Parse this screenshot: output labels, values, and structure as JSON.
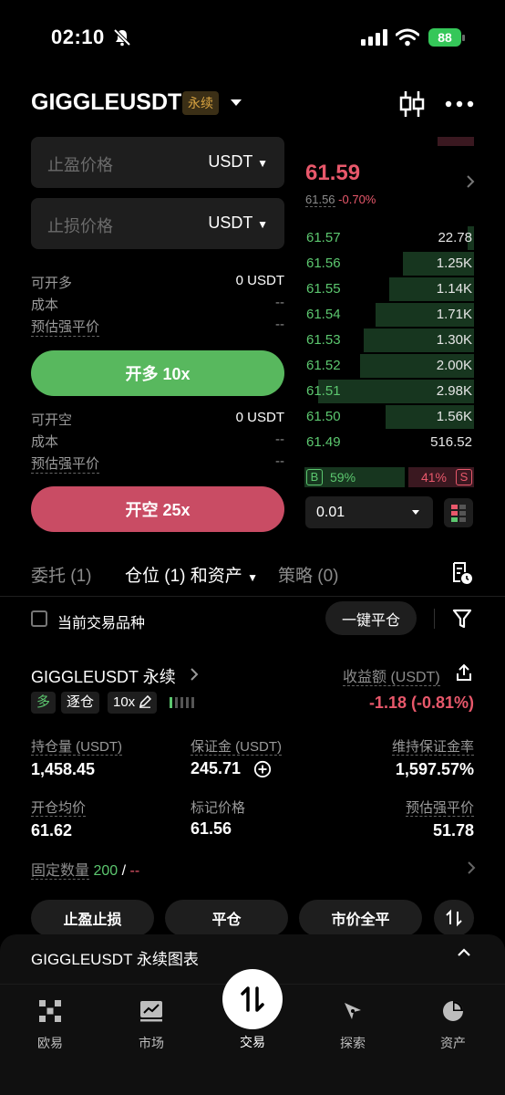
{
  "status": {
    "time": "02:10",
    "battery": "88"
  },
  "header": {
    "symbol": "GIGGLEUSDT",
    "tag": "永续"
  },
  "inputs": [
    {
      "placeholder": "止盈价格",
      "unit": "USDT"
    },
    {
      "placeholder": "止损价格",
      "unit": "USDT"
    }
  ],
  "long": {
    "rows": [
      {
        "label": "可开多",
        "value": "0 USDT"
      },
      {
        "label": "成本",
        "value": "--"
      },
      {
        "label": "预估强平价",
        "value": "--"
      }
    ],
    "button": "开多 10x"
  },
  "short": {
    "rows": [
      {
        "label": "可开空",
        "value": "0 USDT"
      },
      {
        "label": "成本",
        "value": "--"
      },
      {
        "label": "预估强平价",
        "value": "--"
      }
    ],
    "button": "开空 25x"
  },
  "orderbook": {
    "last_price": "61.59",
    "mark_price": "61.56",
    "change": "-0.70%",
    "bids": [
      {
        "price": "61.57",
        "qty": "22.78",
        "depth": 0.04
      },
      {
        "price": "61.56",
        "qty": "1.25K",
        "depth": 0.42
      },
      {
        "price": "61.55",
        "qty": "1.14K",
        "depth": 0.5
      },
      {
        "price": "61.54",
        "qty": "1.71K",
        "depth": 0.58
      },
      {
        "price": "61.53",
        "qty": "1.30K",
        "depth": 0.65
      },
      {
        "price": "61.52",
        "qty": "2.00K",
        "depth": 0.67
      },
      {
        "price": "61.51",
        "qty": "2.98K",
        "depth": 0.92
      },
      {
        "price": "61.50",
        "qty": "1.56K",
        "depth": 0.52
      },
      {
        "price": "61.49",
        "qty": "516.52",
        "depth": 0
      }
    ],
    "buy_tag": "B",
    "buy_ratio": "59%",
    "buy_fraction": 0.59,
    "sell_tag": "S",
    "sell_ratio": "41%",
    "precision": "0.01"
  },
  "tabs": {
    "orders": "委托 (1)",
    "positions": "仓位 (1) 和资产",
    "strategy": "策略 (0)"
  },
  "filter": {
    "current_symbol": "当前交易品种",
    "close_all": "一键平仓"
  },
  "position": {
    "title": "GIGGLEUSDT 永续",
    "side": "多",
    "margin_mode": "逐仓",
    "leverage": "10x",
    "pnl_label": "收益额 (USDT)",
    "pnl_value": "-1.18 (-0.81%)",
    "stats": [
      {
        "label": "持仓量 (USDT)",
        "value": "1,458.45"
      },
      {
        "label": "保证金 (USDT)",
        "value": "245.71"
      },
      {
        "label": "维持保证金率",
        "value": "1,597.57%"
      },
      {
        "label": "开仓均价",
        "value": "61.62"
      },
      {
        "label": "标记价格",
        "value": "61.56"
      },
      {
        "label": "预估强平价",
        "value": "51.78"
      }
    ],
    "fixed_qty_label": "固定数量",
    "fixed_qty_value": "200",
    "fixed_qty_sep": "/",
    "fixed_qty_rest": "--",
    "actions": [
      "止盈止损",
      "平仓",
      "市价全平"
    ]
  },
  "chart_panel": {
    "title": "GIGGLEUSDT 永续图表"
  },
  "nav": [
    {
      "label": "欧易",
      "icon": "okx-logo-icon"
    },
    {
      "label": "市场",
      "icon": "chart-icon"
    },
    {
      "label": "交易",
      "icon": "trade-arrows-icon"
    },
    {
      "label": "探索",
      "icon": "compass-icon"
    },
    {
      "label": "资产",
      "icon": "pie-icon"
    }
  ]
}
